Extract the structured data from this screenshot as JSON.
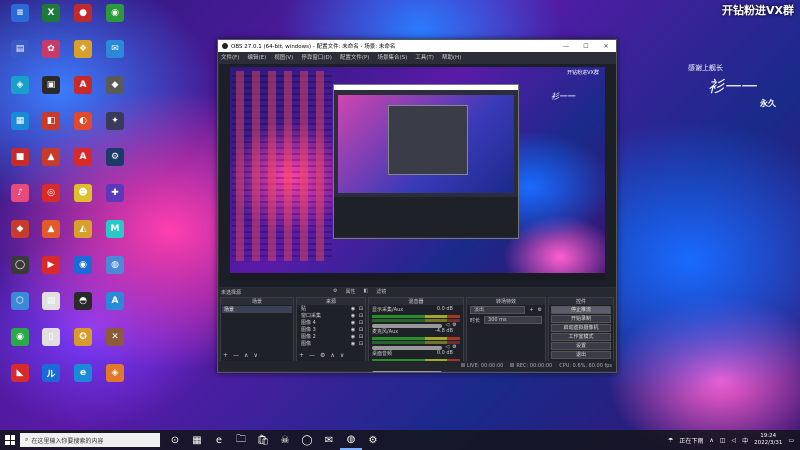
{
  "overlay": {
    "top_right": "开钻粉进VX群",
    "banner_thanks": "感谢上舰长",
    "banner_name": "衫一一",
    "sub_name": "永久"
  },
  "desktop": {
    "icons": [
      {
        "label": "",
        "color": "#2a6ad8",
        "glyph": "≡"
      },
      {
        "label": "",
        "color": "#1d7a3a",
        "glyph": "X"
      },
      {
        "label": "",
        "color": "#c02a2a",
        "glyph": "●"
      },
      {
        "label": "",
        "color": "#2a9a3a",
        "glyph": "◉"
      },
      {
        "label": "",
        "color": "#3a5ac8",
        "glyph": "▤"
      },
      {
        "label": "",
        "color": "#c83a6a",
        "glyph": "✿"
      },
      {
        "label": "",
        "color": "#d8a02a",
        "glyph": "❖"
      },
      {
        "label": "",
        "color": "#2a8ad8",
        "glyph": "✉"
      },
      {
        "label": "",
        "color": "#18a0c8",
        "glyph": "◈"
      },
      {
        "label": "",
        "color": "#2a2a2a",
        "glyph": "▣"
      },
      {
        "label": "",
        "color": "#c82a2a",
        "glyph": "A"
      },
      {
        "label": "",
        "color": "#5a5a5a",
        "glyph": "◆"
      },
      {
        "label": "",
        "color": "#1a8ad8",
        "glyph": "▦"
      },
      {
        "label": "",
        "color": "#c83a2a",
        "glyph": "◧"
      },
      {
        "label": "",
        "color": "#e04a2a",
        "glyph": "◐"
      },
      {
        "label": "",
        "color": "#3a3a5a",
        "glyph": "✦"
      },
      {
        "label": "",
        "color": "#c82a2a",
        "glyph": "■"
      },
      {
        "label": "",
        "color": "#c83a2a",
        "glyph": "▲"
      },
      {
        "label": "",
        "color": "#d82a2a",
        "glyph": "A"
      },
      {
        "label": "",
        "color": "#1a3a6a",
        "glyph": "⚙"
      },
      {
        "label": "",
        "color": "#e84a7a",
        "glyph": "♪"
      },
      {
        "label": "",
        "color": "#d82a2a",
        "glyph": "◎"
      },
      {
        "label": "",
        "color": "#e0c02a",
        "glyph": "☻"
      },
      {
        "label": "",
        "color": "#5a3ab8",
        "glyph": "✚"
      },
      {
        "label": "",
        "color": "#c83a2a",
        "glyph": "◆"
      },
      {
        "label": "",
        "color": "#e05a2a",
        "glyph": "▲"
      },
      {
        "label": "",
        "color": "#d8a02a",
        "glyph": "◭"
      },
      {
        "label": "",
        "color": "#2ac8c8",
        "glyph": "M"
      },
      {
        "label": "",
        "color": "#3a3a3a",
        "glyph": "◯"
      },
      {
        "label": "",
        "color": "#d82a2a",
        "glyph": "▶"
      },
      {
        "label": "",
        "color": "#1a6ad8",
        "glyph": "◉"
      },
      {
        "label": "",
        "color": "#4a8ad8",
        "glyph": "◍"
      },
      {
        "label": "",
        "color": "#3a8ad8",
        "glyph": "⬡"
      },
      {
        "label": "",
        "color": "#e0e0e0",
        "glyph": "▤"
      },
      {
        "label": "",
        "color": "#2a2a2a",
        "glyph": "◓"
      },
      {
        "label": "",
        "color": "#2a8ad8",
        "glyph": "A"
      },
      {
        "label": "",
        "color": "#2aa84a",
        "glyph": "◉"
      },
      {
        "label": "",
        "color": "#e0e0e0",
        "glyph": "▯"
      },
      {
        "label": "",
        "color": "#d89a2a",
        "glyph": "✪"
      },
      {
        "label": "",
        "color": "#8a5a3a",
        "glyph": "✕"
      },
      {
        "label": "",
        "color": "#d82a2a",
        "glyph": "◣"
      },
      {
        "label": "",
        "color": "#1a6ad8",
        "glyph": "ル"
      },
      {
        "label": "",
        "color": "#1a8ad8",
        "glyph": "e"
      },
      {
        "label": "",
        "color": "#e07a2a",
        "glyph": "◈"
      }
    ]
  },
  "obs": {
    "title": "OBS 27.0.1 (64-bit, windows) - 配置文件: 未命名 - 场景: 未命名",
    "menu": [
      "文件(F)",
      "编辑(E)",
      "视图(V)",
      "停靠窗口(D)",
      "配置文件(P)",
      "场景集合(S)",
      "工具(T)",
      "帮助(H)"
    ],
    "preview_badge": "开钻粉进VX群",
    "preview_name": "衫一一",
    "dock_label": "未选择源",
    "preview_controls": [
      "属性",
      "滤镜"
    ],
    "scenes_header": "场景",
    "scenes": [
      "场景"
    ],
    "sources_header": "来源",
    "sources": [
      "贴",
      "窗口采集",
      "图像 4",
      "图像 3",
      "图像 2",
      "图像"
    ],
    "mixer_header": "混音器",
    "mixer": [
      {
        "name": "显示采集/Aux",
        "db": "0.0 dB"
      },
      {
        "name": "麦克风/Aux",
        "db": "-4.8 dB"
      },
      {
        "name": "桌面音频",
        "db": "0.0 dB"
      }
    ],
    "transitions_header": "转场特效",
    "transition_type": "淡出",
    "duration_label": "时长",
    "duration_value": "300 ms",
    "controls_header": "控件",
    "controls": [
      "停止推流",
      "开始录制",
      "启动虚拟摄像机",
      "工作室模式",
      "设置",
      "退出"
    ],
    "status": [
      "LIVE: 00:00:00",
      "REC: 00:00:00",
      "CPU: 0.6%, 60.00 fps"
    ]
  },
  "taskbar": {
    "search_placeholder": "在这里输入你要搜索的内容",
    "apps": [
      "⊙",
      "▦",
      "e",
      "🗀",
      "🛍",
      "☠",
      "◯",
      "✉",
      "◍",
      "⚙"
    ],
    "weather": "正在下雨",
    "time": "19:24",
    "date": "2022/3/31"
  }
}
